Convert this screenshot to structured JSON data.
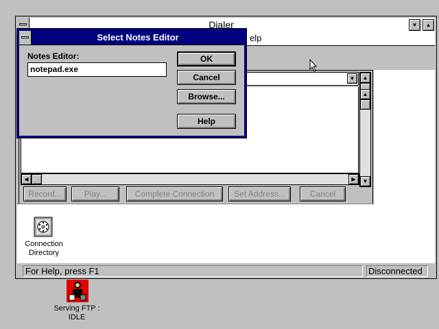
{
  "dialer": {
    "title": "Dialer",
    "menu_partial": "elp",
    "buttons": {
      "record": "Record...",
      "play": "Play...",
      "complete": "Complete Connection",
      "set_address": "Set Address...",
      "cancel": "Cancel"
    },
    "desktop_icon_label": "Connection Directory",
    "status_help": "For Help, press F1",
    "status_conn": "Disconnected"
  },
  "dialog": {
    "title": "Select Notes Editor",
    "field_label": "Notes Editor:",
    "field_value": "notepad.exe",
    "ok": "OK",
    "cancel": "Cancel",
    "browse": "Browse...",
    "help": "Help"
  },
  "desktop": {
    "ftp_label_1": "Serving FTP :",
    "ftp_label_2": "IDLE"
  },
  "colors": {
    "desktop": "#c0c0c0",
    "title_active": "#000080",
    "title_inactive": "#ffffff"
  }
}
